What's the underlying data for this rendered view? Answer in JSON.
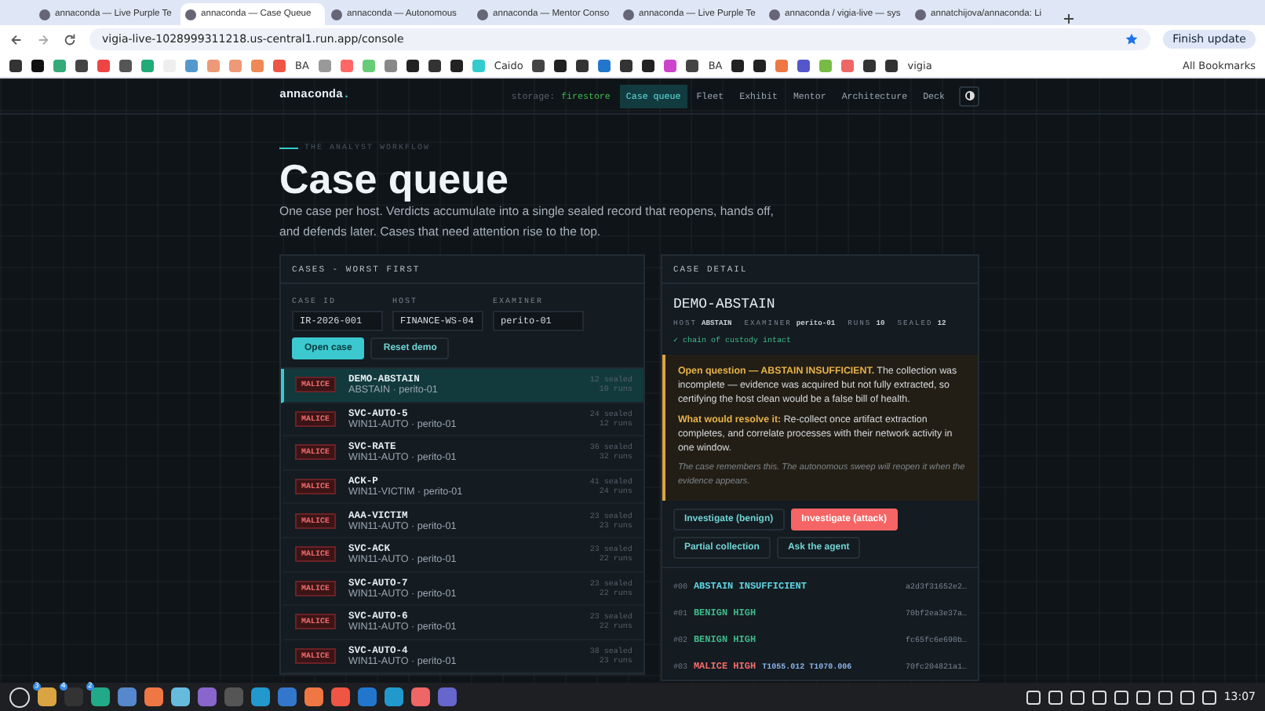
{
  "browser": {
    "tabs": [
      {
        "title": "annaconda — Live Purple Te",
        "selected": false
      },
      {
        "title": "annaconda — Case Queue",
        "selected": true
      },
      {
        "title": "annaconda — Autonomous",
        "selected": false
      },
      {
        "title": "annaconda — Mentor Conso",
        "selected": false
      },
      {
        "title": "annaconda — Live Purple Te",
        "selected": false
      },
      {
        "title": "annaconda / vigia-live — sys",
        "selected": false
      },
      {
        "title": "annatchijova/annaconda: Li",
        "selected": false
      }
    ],
    "address": "vigia-live-1028999311218.us-central1.run.app/console",
    "update_button": "Finish update",
    "bookmarks": [
      {
        "label": "BA"
      },
      {
        "label": "Caido"
      },
      {
        "label": "BA"
      },
      {
        "label": "vigia"
      }
    ],
    "all_bookmarks": "All Bookmarks"
  },
  "header": {
    "brand": "annaconda",
    "brand_dot": ".",
    "storage_label": "storage:",
    "storage_value": "firestore",
    "nav": [
      {
        "label": "Case queue",
        "selected": true
      },
      {
        "label": "Fleet",
        "selected": false
      },
      {
        "label": "Exhibit",
        "selected": false
      },
      {
        "label": "Mentor",
        "selected": false
      },
      {
        "label": "Architecture",
        "selected": false
      },
      {
        "label": "Deck",
        "selected": false
      }
    ]
  },
  "hero": {
    "eyebrow": "THE ANALYST WORKFLOW",
    "title": "Case queue",
    "description": "One case per host. Verdicts accumulate into a single sealed record that reopens, hands off, and defends later. Cases that need attention rise to the top."
  },
  "cases": {
    "title": "CASES - WORST FIRST",
    "fields": [
      {
        "label": "CASE ID",
        "value": "IR-2026-001"
      },
      {
        "label": "HOST",
        "value": "FINANCE-WS-04"
      },
      {
        "label": "EXAMINER",
        "value": "perito-01"
      }
    ],
    "buttons": [
      {
        "label": "Open case",
        "kind": "primary"
      },
      {
        "label": "Reset demo",
        "kind": "secondary"
      }
    ],
    "rows": [
      {
        "verdict": "MALICE",
        "name": "DEMO-ABSTAIN",
        "sub": "ABSTAIN · perito-01",
        "sealed": "12 sealed",
        "runs": "10 runs",
        "selected": true
      },
      {
        "verdict": "MALICE",
        "name": "SVC-AUTO-5",
        "sub": "WIN11-AUTO · perito-01",
        "sealed": "24 sealed",
        "runs": "12 runs",
        "selected": false
      },
      {
        "verdict": "MALICE",
        "name": "SVC-RATE",
        "sub": "WIN11-AUTO · perito-01",
        "sealed": "36 sealed",
        "runs": "32 runs",
        "selected": false
      },
      {
        "verdict": "MALICE",
        "name": "ACK-P",
        "sub": "WIN11-VICTIM · perito-01",
        "sealed": "41 sealed",
        "runs": "24 runs",
        "selected": false
      },
      {
        "verdict": "MALICE",
        "name": "AAA-VICTIM",
        "sub": "WIN11-AUTO · perito-01",
        "sealed": "23 sealed",
        "runs": "23 runs",
        "selected": false
      },
      {
        "verdict": "MALICE",
        "name": "SVC-ACK",
        "sub": "WIN11-AUTO · perito-01",
        "sealed": "23 sealed",
        "runs": "22 runs",
        "selected": false
      },
      {
        "verdict": "MALICE",
        "name": "SVC-AUTO-7",
        "sub": "WIN11-AUTO · perito-01",
        "sealed": "23 sealed",
        "runs": "22 runs",
        "selected": false
      },
      {
        "verdict": "MALICE",
        "name": "SVC-AUTO-6",
        "sub": "WIN11-AUTO · perito-01",
        "sealed": "23 sealed",
        "runs": "22 runs",
        "selected": false
      },
      {
        "verdict": "MALICE",
        "name": "SVC-AUTO-4",
        "sub": "WIN11-AUTO · perito-01",
        "sealed": "38 sealed",
        "runs": "23 runs",
        "selected": false
      }
    ]
  },
  "detail": {
    "title": "CASE DETAIL",
    "name": "DEMO-ABSTAIN",
    "meta": [
      {
        "label": "HOST",
        "value": "ABSTAIN"
      },
      {
        "label": "EXAMINER",
        "value": "perito-01"
      },
      {
        "label": "RUNS",
        "value": "10"
      },
      {
        "label": "SEALED",
        "value": "12"
      }
    ],
    "custody": "✓ chain of custody intact",
    "question": "**Open question — ABSTAIN INSUFFICIENT.** The collection was incomplete — evidence was acquired but not fully extracted, so certifying the host clean would be a false bill of health.",
    "resolve": "**What would resolve it:** Re-collect once artifact extraction completes, and correlate processes with their network activity in one window.",
    "note": "The case remembers this. The autonomous sweep will reopen it when the evidence appears.",
    "actions": [
      {
        "label": "Investigate (benign)",
        "kind": "outline"
      },
      {
        "label": "Investigate (attack)",
        "kind": "danger"
      },
      {
        "label": "Partial collection",
        "kind": "outline"
      },
      {
        "label": "Ask the agent",
        "kind": "outline"
      }
    ],
    "history": [
      {
        "index": "#00",
        "verdict": "ABSTAIN INSUFFICIENT",
        "kind": "abstain",
        "hash": "a2d3f31652e2…"
      },
      {
        "index": "#01",
        "verdict": "BENIGN HIGH",
        "kind": "benign",
        "hash": "70bf2ea3e37a…"
      },
      {
        "index": "#02",
        "verdict": "BENIGN HIGH",
        "kind": "benign",
        "hash": "fc65fc6e690b…"
      },
      {
        "index": "#03",
        "verdict": "MALICE HIGH",
        "kind": "malice",
        "tags": "T1055.012 T1070.006",
        "hash": "70fc204821a1…"
      }
    ]
  },
  "taskbar": {
    "badges": [
      "3",
      "4",
      "2"
    ],
    "time": "13:07"
  }
}
